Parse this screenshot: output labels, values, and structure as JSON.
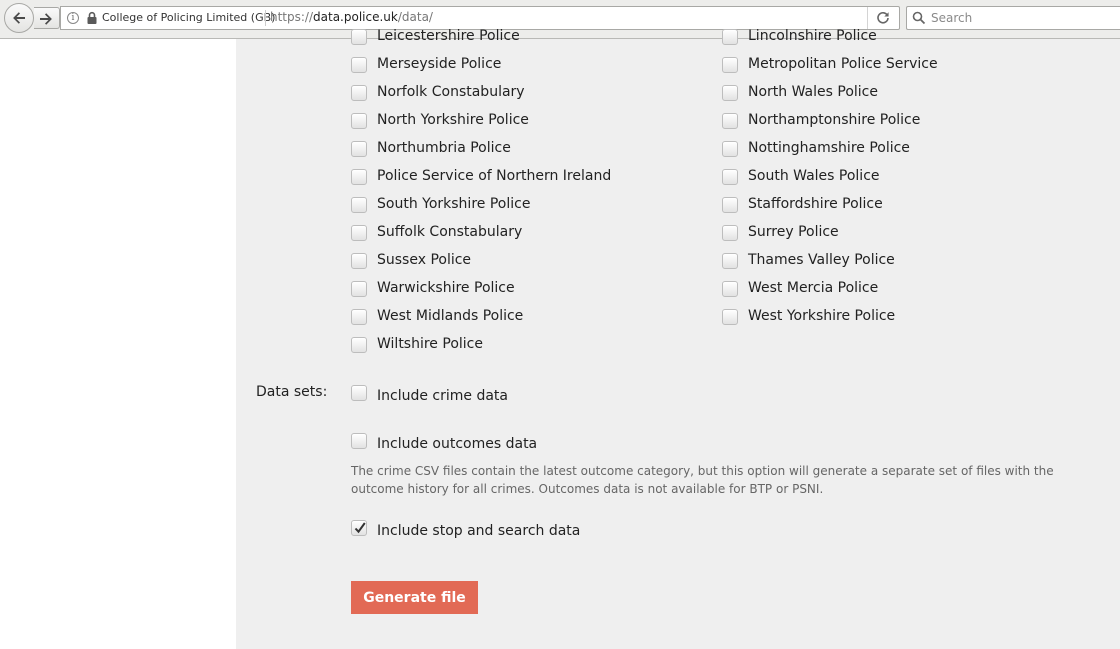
{
  "browser": {
    "identity": "College of Policing Limited (GB)",
    "url_scheme": "https://",
    "url_domain": "data.police.uk",
    "url_path": "/data/",
    "search_placeholder": "Search"
  },
  "forces": [
    {
      "left": "Leicestershire Police",
      "right": "Lincolnshire Police"
    },
    {
      "left": "Merseyside Police",
      "right": "Metropolitan Police Service"
    },
    {
      "left": "Norfolk Constabulary",
      "right": "North Wales Police"
    },
    {
      "left": "North Yorkshire Police",
      "right": "Northamptonshire Police"
    },
    {
      "left": "Northumbria Police",
      "right": "Nottinghamshire Police"
    },
    {
      "left": "Police Service of Northern Ireland",
      "right": "South Wales Police"
    },
    {
      "left": "South Yorkshire Police",
      "right": "Staffordshire Police"
    },
    {
      "left": "Suffolk Constabulary",
      "right": "Surrey Police"
    },
    {
      "left": "Sussex Police",
      "right": "Thames Valley Police"
    },
    {
      "left": "Warwickshire Police",
      "right": "West Mercia Police"
    },
    {
      "left": "West Midlands Police",
      "right": "West Yorkshire Police"
    },
    {
      "left": "Wiltshire Police",
      "right": null
    }
  ],
  "datasets": {
    "label": "Data sets:",
    "crime": {
      "label": "Include crime data",
      "checked": false
    },
    "outcomes": {
      "label": "Include outcomes data",
      "checked": false
    },
    "note": "The crime CSV files contain the latest outcome category, but this option will generate a separate set of files with the outcome history for all crimes. Outcomes data is not available for BTP or PSNI.",
    "stop_search": {
      "label": "Include stop and search data",
      "checked": true
    }
  },
  "generate_button": "Generate file",
  "colors": {
    "panel_bg": "#efefef",
    "button_bg": "#e26a55",
    "note_text": "#666666"
  }
}
